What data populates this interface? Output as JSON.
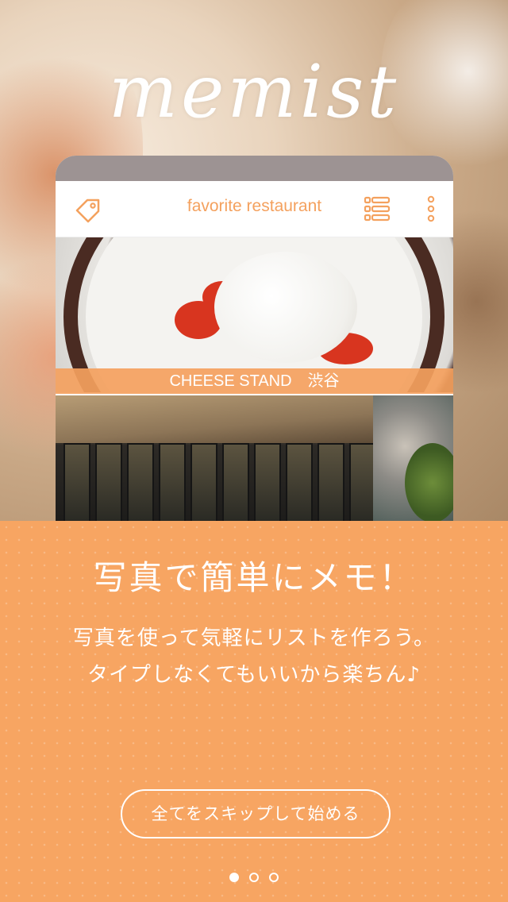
{
  "app": {
    "logo_text": "memist"
  },
  "phone_preview": {
    "nav_title": "favorite restaurant",
    "left_icon": "tag-icon",
    "right_icons": [
      "list-icon",
      "more-vertical-icon"
    ],
    "items": [
      {
        "caption": "CHEESE STAND　渋谷"
      }
    ]
  },
  "intro": {
    "headline": "写真で簡単にメモ！",
    "line1": "写真を使って気軽にリストを作ろう。",
    "line2": "タイプしなくてもいいから楽ちん♪",
    "skip_label": "全てをスキップして始める"
  },
  "pager": {
    "count": 3,
    "active_index": 0
  },
  "colors": {
    "accent": "#f7a562",
    "status_bar": "#9d9393",
    "nav_text": "#f4a15e"
  }
}
